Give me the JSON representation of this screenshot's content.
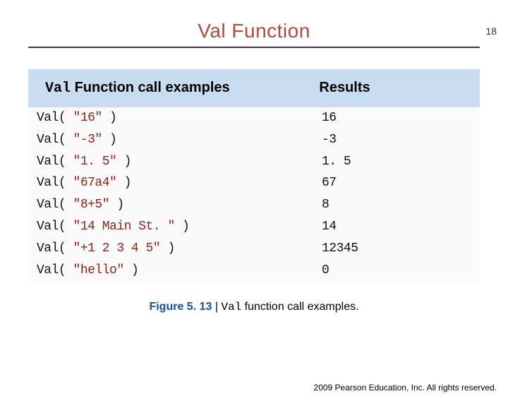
{
  "page_number": "18",
  "title": "Val Function",
  "table": {
    "header_call_prefix": "Val",
    "header_call_suffix": " Function call examples",
    "header_result": "Results",
    "rows": [
      {
        "fn": "Val( ",
        "arg": "\"16\"",
        "end": " )",
        "result": "16"
      },
      {
        "fn": "Val( ",
        "arg": "\"-3\"",
        "end": " )",
        "result": "-3"
      },
      {
        "fn": "Val( ",
        "arg": "\"1. 5\"",
        "end": " )",
        "result": "1. 5"
      },
      {
        "fn": "Val( ",
        "arg": "\"67a4\"",
        "end": " )",
        "result": "67"
      },
      {
        "fn": "Val( ",
        "arg": "\"8+5\"",
        "end": " )",
        "result": "8"
      },
      {
        "fn": "Val( ",
        "arg": "\"14 Main St. \"",
        "end": " )",
        "result": "14"
      },
      {
        "fn": "Val( ",
        "arg": "\"+1 2 3 4 5\"",
        "end": " )",
        "result": "12345"
      },
      {
        "fn": "Val( ",
        "arg": "\"hello\"",
        "end": " )",
        "result": "0"
      }
    ]
  },
  "caption": {
    "label": "Figure 5. 13",
    "separator": " | ",
    "code": "Val",
    "rest": " function call examples."
  },
  "copyright": "  2009 Pearson Education, Inc.  All rights reserved."
}
